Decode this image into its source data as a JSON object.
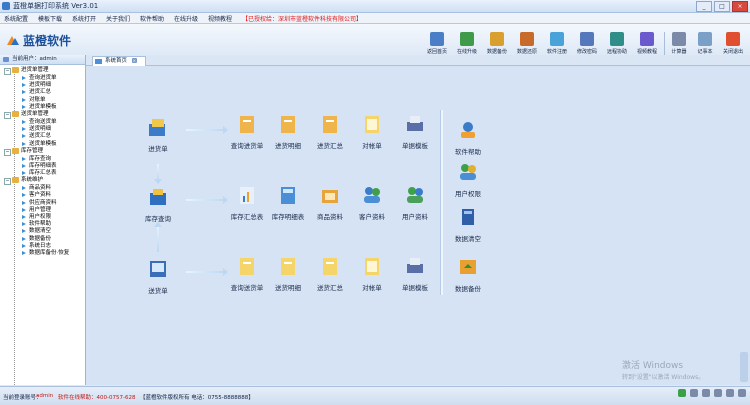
{
  "window": {
    "title": "蓝橙单据打印系统 Ver3.01",
    "buttons": [
      "_",
      "□",
      "×"
    ]
  },
  "menu": {
    "items": [
      "系统配置",
      "模板下载",
      "系统打开",
      "关于我们",
      "软件帮助",
      "在线升级",
      "视频教程"
    ],
    "notice": "【已授权给：深圳市蓝橙软件科技有限公司】"
  },
  "brand": {
    "name": "蓝橙软件"
  },
  "toolbar": {
    "buttons": [
      {
        "label": "返回首页",
        "color": "#4a7fc8"
      },
      {
        "label": "在线升级",
        "color": "#3f9a4a"
      },
      {
        "label": "数据备份",
        "color": "#d9a030"
      },
      {
        "label": "数据还原",
        "color": "#c86a2a"
      },
      {
        "label": "软件注册",
        "color": "#4aa3d8"
      },
      {
        "label": "修改密码",
        "color": "#5577bb"
      },
      {
        "label": "远程协助",
        "color": "#2f8f88"
      },
      {
        "label": "视频教程",
        "color": "#6a5acd"
      },
      {
        "label": "计算器",
        "color": "#7a8aa8"
      },
      {
        "label": "记事本",
        "color": "#7aa0c8"
      },
      {
        "label": "关闭退出",
        "color": "#e05030"
      }
    ]
  },
  "sidebar": {
    "header": "当前用户：admin",
    "groups": [
      {
        "label": "进货单管理",
        "items": [
          "查询进货单",
          "进货明细",
          "进货汇总",
          "对账单",
          "进货单模板"
        ]
      },
      {
        "label": "送货单管理",
        "items": [
          "查询送货单",
          "送货明细",
          "送货汇总",
          "送货单模板"
        ]
      },
      {
        "label": "库存管理",
        "items": [
          "库存查询",
          "库存明细表",
          "库存汇总表"
        ]
      },
      {
        "label": "系统维护",
        "items": [
          "商品资料",
          "客户资料",
          "供应商资料",
          "用户管理",
          "用户权限",
          "软件帮助",
          "数据清空",
          "数据备份",
          "系统日志",
          "数据库备份·恢复"
        ]
      }
    ]
  },
  "tab": {
    "label": "系统首页"
  },
  "flow": {
    "row1": {
      "start": "进货单",
      "items": [
        "查询进货单",
        "进货明细",
        "进货汇总",
        "对帐单",
        "单据模板"
      ]
    },
    "row2": {
      "start": "库存查询",
      "items": [
        "库存汇总表",
        "库存明细表",
        "商品资料",
        "客户资料",
        "用户资料"
      ]
    },
    "row3": {
      "start": "送货单",
      "items": [
        "查询送货单",
        "送货明细",
        "送货汇总",
        "对帐单",
        "单据模板"
      ]
    },
    "right": [
      "软件帮助",
      "用户权限",
      "数据清空",
      "数据备份"
    ]
  },
  "watermark": {
    "line1": "激活 Windows",
    "line2": "转到\"设置\"以激活 Windows。"
  },
  "status": {
    "left": "当前登录账号：",
    "user": "admin",
    "contact": "软件在线帮助：400-0757-628",
    "company": "【蓝橙软件版权所有 电话：0755-8888888】"
  }
}
